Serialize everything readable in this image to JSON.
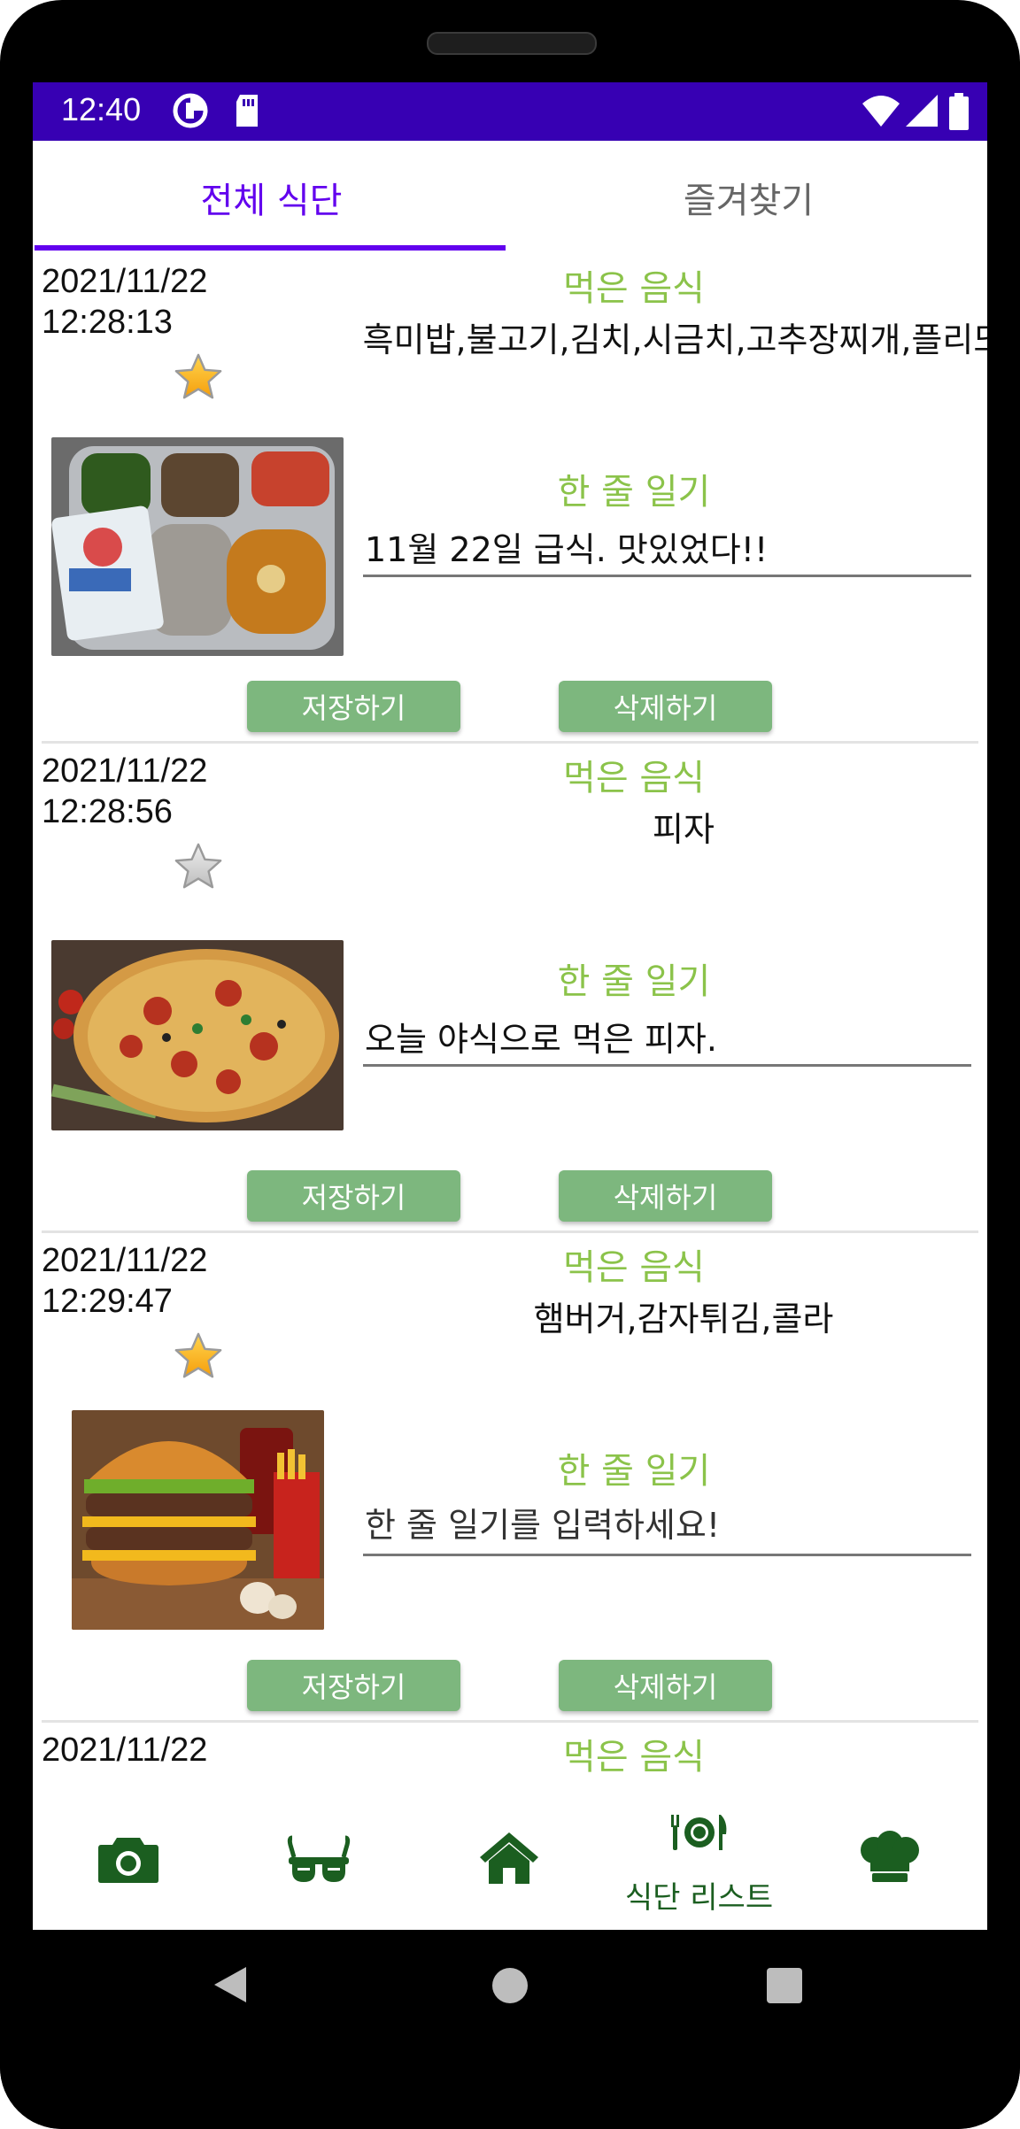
{
  "status_bar": {
    "time": "12:40",
    "left_icons": [
      "data-saver-icon",
      "sd-card-icon"
    ],
    "right_icons": [
      "wifi-icon",
      "signal-icon",
      "battery-icon"
    ],
    "background": "#3700B3"
  },
  "tabs": [
    {
      "label": "전체 식단",
      "active": true
    },
    {
      "label": "즐겨찾기",
      "active": false
    }
  ],
  "accent_color": "#6200EE",
  "label_color": "#8BC34A",
  "button_color": "#7DB77E",
  "items": [
    {
      "date": "2021/11/22",
      "time": "12:28:13",
      "favorite": true,
      "food_label": "먹은 음식",
      "food": "흑미밥,불고기,김치,시금치,고추장찌개,플리또",
      "diary_label": "한 줄 일기",
      "diary": "11월 22일 급식. 맛있었다!!",
      "save_label": "저장하기",
      "delete_label": "삭제하기"
    },
    {
      "date": "2021/11/22",
      "time": "12:28:56",
      "favorite": false,
      "food_label": "먹은 음식",
      "food": "피자",
      "diary_label": "한 줄 일기",
      "diary": "오늘 야식으로 먹은 피자.",
      "save_label": "저장하기",
      "delete_label": "삭제하기"
    },
    {
      "date": "2021/11/22",
      "time": "12:29:47",
      "favorite": true,
      "food_label": "먹은 음식",
      "food": "햄버거,감자튀김,콜라",
      "diary_label": "한 줄 일기",
      "diary_placeholder": "한 줄 일기를 입력하세요!",
      "save_label": "저장하기",
      "delete_label": "삭제하기"
    },
    {
      "date": "2021/11/22",
      "food_label": "먹은 음식"
    }
  ],
  "bottom_nav": [
    {
      "icon": "camera-icon"
    },
    {
      "icon": "glasses-icon"
    },
    {
      "icon": "home-icon"
    },
    {
      "icon": "dining-icon",
      "label": "식단 리스트",
      "active": true
    },
    {
      "icon": "chef-hat-icon"
    }
  ]
}
